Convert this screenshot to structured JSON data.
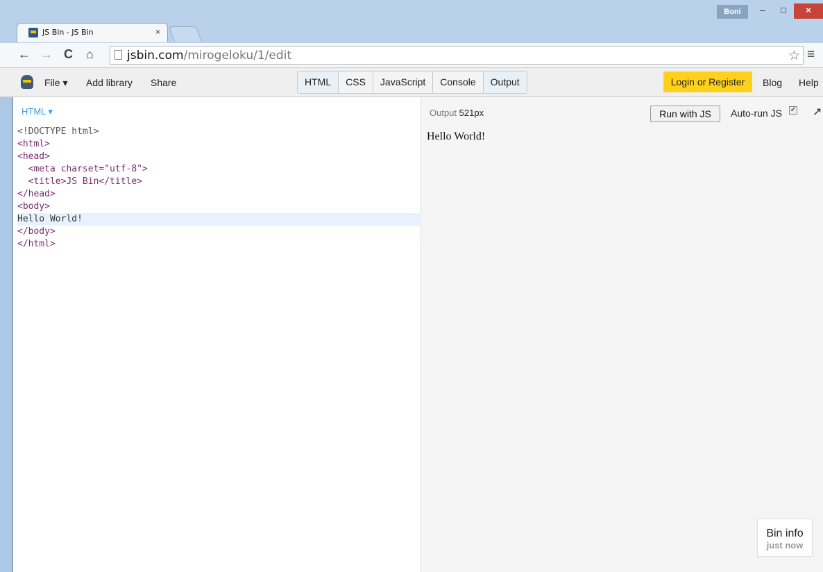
{
  "browser": {
    "tab_title": "JS Bin - JS Bin",
    "tab_close": "×",
    "user": "Boni",
    "window_controls": {
      "minimize": "–",
      "maximize": "□",
      "close": "×"
    },
    "url_host": "jsbin.com",
    "url_path": "/mirogeloku/1/edit",
    "nav": {
      "back": "←",
      "forward": "→",
      "reload": "C",
      "home": "⌂",
      "star": "☆",
      "menu": "≡"
    }
  },
  "jsbin": {
    "menu": {
      "file": "File ▾",
      "add_library": "Add library",
      "share": "Share"
    },
    "panels": [
      "HTML",
      "CSS",
      "JavaScript",
      "Console",
      "Output"
    ],
    "login": "Login or Register",
    "blog": "Blog",
    "help": "Help"
  },
  "editor": {
    "label": "HTML ▾",
    "lines": [
      "<!DOCTYPE html>",
      "<html>",
      "<head>",
      "  <meta charset=\"utf-8\">",
      "  <title>JS Bin</title>",
      "</head>",
      "<body>",
      "Hello World!",
      "</body>",
      "</html>"
    ]
  },
  "output": {
    "label": "Output",
    "size": "521px",
    "run_button": "Run with JS",
    "autorun_label": "Auto-run JS",
    "autorun_checked": true,
    "popout": "↗",
    "content": "Hello World!",
    "bin_info_title": "Bin info",
    "bin_info_time": "just now"
  }
}
